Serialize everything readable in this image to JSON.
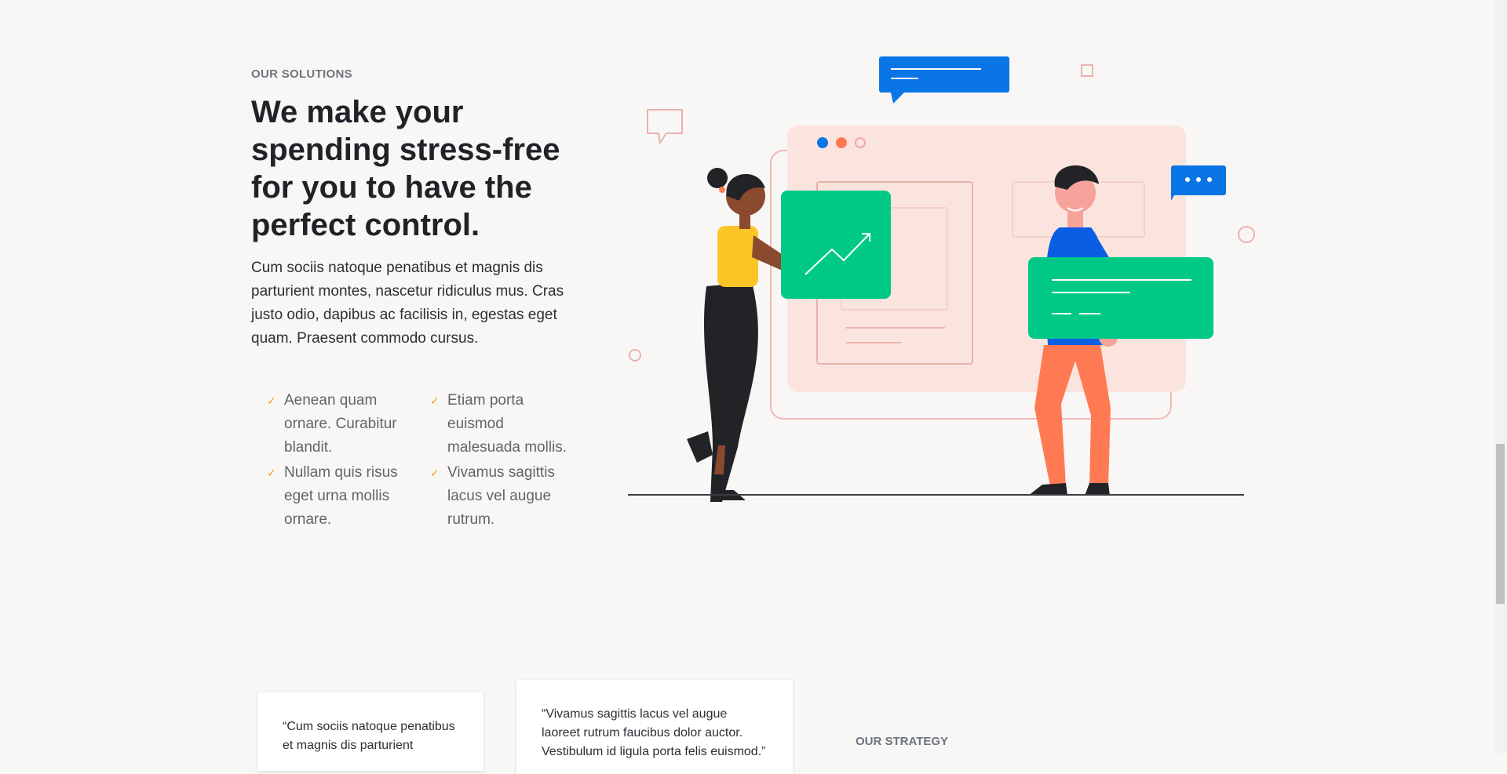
{
  "section": {
    "eyebrow": "OUR SOLUTIONS",
    "headline": "We make your spending stress-free for you to have the perfect control.",
    "intro": "Cum sociis natoque penatibus et magnis dis parturient montes, nascetur ridiculus mus. Cras justo odio, dapibus ac facilisis in, egestas eget quam. Praesent commodo cursus.",
    "features": [
      {
        "icon": "check-icon",
        "text": "Aenean quam ornare. Curabitur blandit."
      },
      {
        "icon": "check-icon",
        "text": "Etiam porta euismod malesuada mollis."
      },
      {
        "icon": "check-icon",
        "text": "Nullam quis risus eget urna mollis ornare."
      },
      {
        "icon": "check-icon",
        "text": "Vivamus sagittis lacus vel augue rutrum."
      }
    ]
  },
  "testimonials": [
    {
      "quote": "“Cum sociis natoque penatibus et magnis dis parturient"
    },
    {
      "quote": "“Vivamus sagittis lacus vel augue laoreet rutrum faucibus dolor auctor. Vestibulum id ligula porta felis euismod.”"
    }
  ],
  "strategy": {
    "eyebrow": "OUR STRATEGY"
  },
  "colors": {
    "accent_blue": "#0a75e4",
    "accent_green": "#00c987",
    "accent_orange": "#ff7a52",
    "check": "#f2a024",
    "background": "#f9f7f6"
  }
}
